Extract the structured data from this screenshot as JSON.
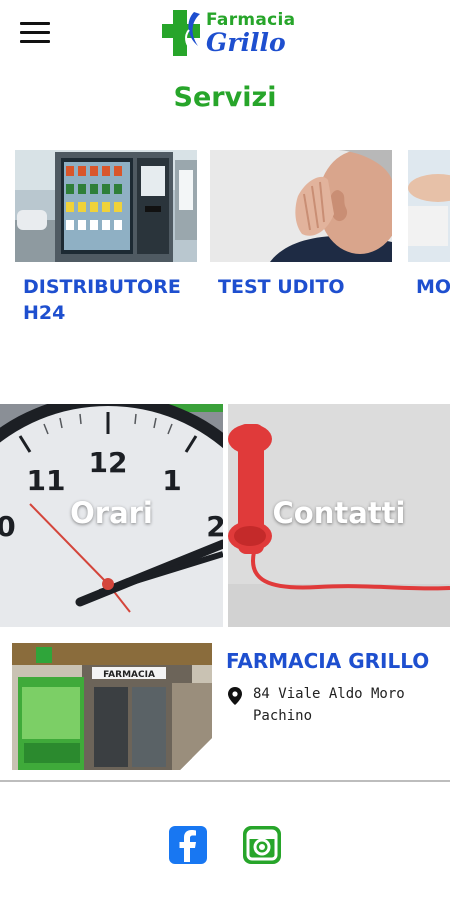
{
  "header": {
    "logo_line1": "Farmacia",
    "logo_line2": "Grillo",
    "menu_icon": "hamburger-menu-icon"
  },
  "page_title": "Servizi",
  "services": [
    {
      "label": "DISTRIBUTORE\nH24"
    },
    {
      "label": "TEST UDITO"
    },
    {
      "label": "MO"
    }
  ],
  "tiles": [
    {
      "label": "Orari"
    },
    {
      "label": "Contatti"
    }
  ],
  "clock_numbers": [
    "11",
    "12",
    "1",
    "0",
    "2"
  ],
  "store": {
    "name": "FARMACIA GRILLO",
    "address_line1": "84 Viale Aldo Moro",
    "address_line2": "Pachino",
    "sign_text": "FARMACIA"
  },
  "social": {
    "facebook_icon": "facebook-icon",
    "instagram_icon": "instagram-icon"
  },
  "colors": {
    "brand_green": "#27a52a",
    "brand_blue": "#1e4fcf",
    "facebook_blue": "#1877f2"
  }
}
